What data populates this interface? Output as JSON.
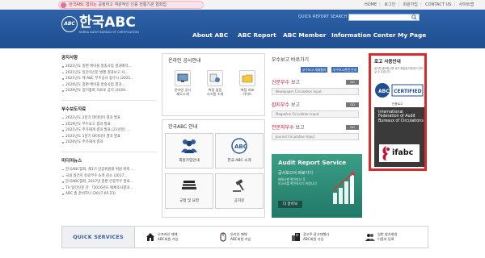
{
  "colors": {
    "header_blue": "#2a5ca2",
    "accent_red": "#c8102e",
    "guide_border": "#d72a2a",
    "audit_green": "#2f8f79"
  },
  "topbar": {
    "badge_prefix": "한국ABC 협회는",
    "badge_text": " 공정하고 객관적인 인증 전통기관 협회입",
    "links": [
      "HOME",
      "로그인",
      "회원가입",
      "CONTACT US",
      "사이트맵"
    ]
  },
  "header": {
    "logo_text": "한국ABC",
    "logo_circle": "ABC",
    "logo_sub": "KOREA AUDIT BUREAU OF CERTIFICATION",
    "quick_search_label": "QUICK REPORT SEARCH",
    "quick_search_icon": "search-icon",
    "nav": [
      "About ABC",
      "ABC Report",
      "ABC Member",
      "Information Center",
      "My Page"
    ]
  },
  "left": {
    "notice_title": "공지사항",
    "notice_items": [
      "2021년도 종편·케이블 방송사업 결과예약...",
      "2021년도 일간지신문 발행 결과보고 사...",
      "2021년도 제 ABC 부수공사 접수시 (2021...",
      "2020년도 종편·케이블 방송사업 결과...",
      "2020년도 정기총회 자료로 공지 (2020..."
    ],
    "report_title": "부수보도자료",
    "report_items": [
      "2021년도 2분기 데이터이 결과 발표",
      "2019년도 부수보고 결과 발표",
      "2021년도 주가재개 결과 발표 (21년분) ...",
      "2021년도 1분기 데이터이 결과 발표",
      "2020년도 주가재개 결과"
    ],
    "media_title": "미디어뉴스",
    "media_items": [
      "한국ABC협회, 제1기 인증위원회 위원 위촉 ...",
      "국내 일간지 유료부수 소폭 감소 (2017...",
      "한국ABC협회, 2017년 종편 인증부수 발표...",
      "TV·일간신문 간 「2016년도 매체조사결과...",
      "ABC 총 준비하나 (2017.05.23)"
    ]
  },
  "online_panel": {
    "title": "온라인 공사안내",
    "tiles": [
      {
        "icon": "monitor-icon",
        "label": "온라인 공사\n제도소개"
      },
      {
        "icon": "process-icon",
        "label": "측정 검증\n시스템 소개"
      },
      {
        "icon": "folder-icon",
        "label": "측정 지표\n가이드"
      }
    ]
  },
  "guide_panel": {
    "title": "한국ABC 안내",
    "tiles": [
      {
        "icon": "members-icon",
        "label": "회원가입안내"
      },
      {
        "icon": "abc-logo-icon",
        "label": "한국 ABC 소개"
      },
      {
        "icon": "books-icon",
        "label": "규정 및 요령"
      },
      {
        "icon": "gavel-icon",
        "label": "공지문"
      }
    ]
  },
  "reports": {
    "title": "부수보고 바로가기",
    "tabs": [
      "부수보고 게재협의",
      "부수보고관련 안내"
    ],
    "blocks": [
      {
        "name": "신문부수",
        "suffix": " 보고",
        "sub": "Newspaper Circulation Input",
        "more": "GO"
      },
      {
        "name": "잡지부수",
        "suffix": " 보고",
        "sub": "Magazine Circulation Input",
        "more": "GO"
      },
      {
        "name": "전문지부수",
        "suffix": " 보고",
        "sub": "Journal Circulation Input",
        "more": "GO"
      }
    ]
  },
  "audit": {
    "title": "Audit Report Service",
    "sub": "공사보고서 바로가기",
    "desc": [
      "매체사별 확인하신 후",
      "보고서를 확인하시기 바랍니다"
    ],
    "button": "더 알아보",
    "chart_icon": "bar-chart-icon"
  },
  "logo_guide": {
    "title": "로고 사용안내",
    "desc": "로고를 클릭하시면 로고 파일을 다운로드 받으실 수 있습니다.",
    "cert_label": "인증로고",
    "cert_badge": "CERTIFIED",
    "ifabc_text": "International Federation of Audit Bureaux of Circulations",
    "ifabc_logo": "ifabc"
  },
  "quick_services": {
    "title": "QUICK SERVICES",
    "items": [
      {
        "icon": "home-icon",
        "label": "오프라인 매체\nABC회원 가입"
      },
      {
        "icon": "mouse-icon",
        "label": "온라인 매체\nABC회원 가입"
      },
      {
        "icon": "building-icon",
        "label": "광고주·광고대행사\nABC회원 가입"
      },
      {
        "icon": "group-icon",
        "label": "일반 참가회원\n이용자 등록"
      }
    ]
  }
}
